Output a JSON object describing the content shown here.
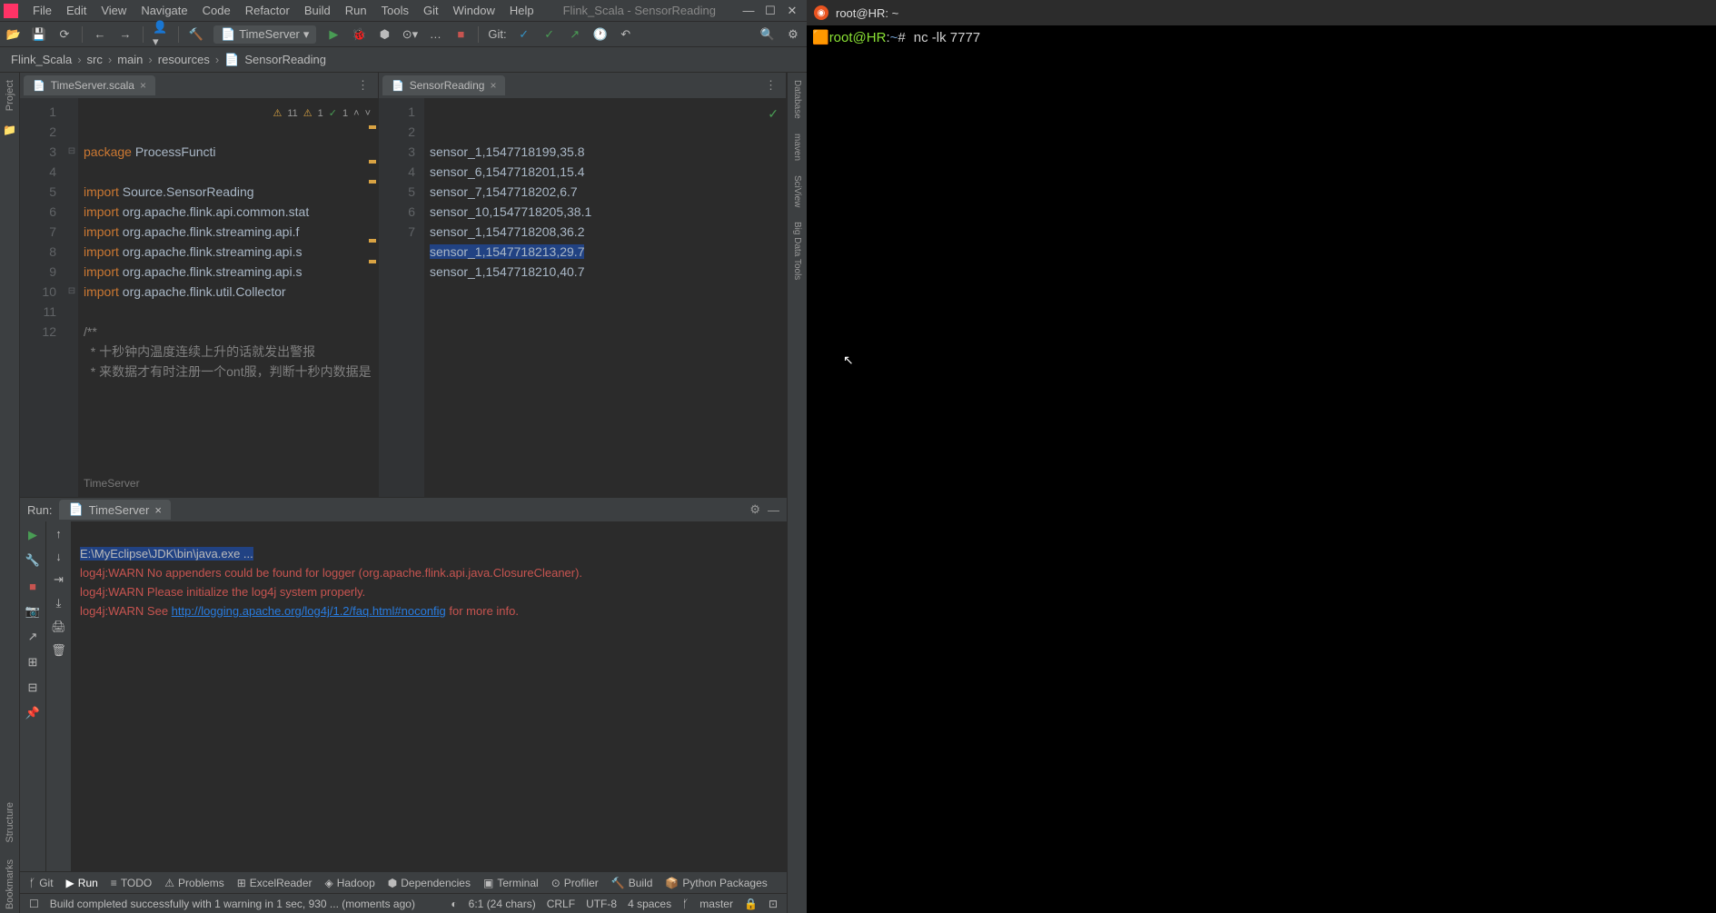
{
  "menubar": {
    "items": [
      "File",
      "Edit",
      "View",
      "Navigate",
      "Code",
      "Refactor",
      "Build",
      "Run",
      "Tools",
      "Git",
      "Window",
      "Help"
    ],
    "project": "Flink_Scala - SensorReading"
  },
  "toolbar": {
    "runconfig": "TimeServer",
    "git_label": "Git:"
  },
  "breadcrumb": [
    "Flink_Scala",
    "src",
    "main",
    "resources",
    "SensorReading"
  ],
  "tabs": {
    "left": "TimeServer.scala",
    "right": "SensorReading"
  },
  "code_left": {
    "lines": [
      {
        "n": "1",
        "t": "package ProcessFuncti",
        "cls": ""
      },
      {
        "n": "2",
        "t": "",
        "cls": ""
      },
      {
        "n": "3",
        "t": "import Source.SensorReading",
        "cls": ""
      },
      {
        "n": "4",
        "t": "import org.apache.flink.api.common.stat",
        "cls": ""
      },
      {
        "n": "5",
        "t": "import org.apache.flink.streaming.api.f",
        "cls": ""
      },
      {
        "n": "6",
        "t": "import org.apache.flink.streaming.api.s",
        "cls": ""
      },
      {
        "n": "7",
        "t": "import org.apache.flink.streaming.api.s",
        "cls": ""
      },
      {
        "n": "8",
        "t": "import org.apache.flink.util.Collector",
        "cls": ""
      },
      {
        "n": "9",
        "t": "",
        "cls": ""
      },
      {
        "n": "10",
        "t": "/**",
        "cls": "comment"
      },
      {
        "n": "11",
        "t": "  * 十秒钟内温度连续上升的话就发出警报",
        "cls": "comment"
      },
      {
        "n": "12",
        "t": "  * 来数据才有时注册一个ont服，判断十秒内数据是",
        "cls": "comment"
      }
    ],
    "indicators": {
      "warn": "11",
      "err": "1",
      "ok": "1"
    },
    "context": "TimeServer"
  },
  "code_right": {
    "lines": [
      {
        "n": "1",
        "t": "sensor_1,1547718199,35.8"
      },
      {
        "n": "2",
        "t": "sensor_6,1547718201,15.4"
      },
      {
        "n": "3",
        "t": "sensor_7,1547718202,6.7"
      },
      {
        "n": "4",
        "t": "sensor_10,1547718205,38.1"
      },
      {
        "n": "5",
        "t": "sensor_1,1547718208,36.2"
      },
      {
        "n": "6",
        "t": "sensor_1,1547718213,29.7",
        "sel": true
      },
      {
        "n": "7",
        "t": "sensor_1,1547718210,40.7"
      }
    ]
  },
  "run": {
    "label": "Run:",
    "tab": "TimeServer",
    "console": {
      "line1": "E:\\MyEclipse\\JDK\\bin\\java.exe ...",
      "line2": "log4j:WARN No appenders could be found for logger (org.apache.flink.api.java.ClosureCleaner).",
      "line3": "log4j:WARN Please initialize the log4j system properly.",
      "line4a": "log4j:WARN See ",
      "line4_link": "http://logging.apache.org/log4j/1.2/faq.html#noconfig",
      "line4b": " for more info."
    }
  },
  "bottom_tabs": [
    "Git",
    "Run",
    "TODO",
    "Problems",
    "ExcelReader",
    "Hadoop",
    "Dependencies",
    "Terminal",
    "Profiler",
    "Build",
    "Python Packages"
  ],
  "status": {
    "build": "Build completed successfully with 1 warning in 1 sec, 930 ... (moments ago)",
    "pos": "6:1 (24 chars)",
    "sep": "CRLF",
    "enc": "UTF-8",
    "indent": "4 spaces",
    "branch": "master"
  },
  "left_side_tabs": [
    "Project",
    "Bookmarks",
    "Structure"
  ],
  "right_side_tabs": [
    "Database",
    "maven",
    "SciView",
    "Big Data Tools"
  ],
  "terminal": {
    "title": "root@HR: ~",
    "prompt_user": "root@HR",
    "prompt_path": "~",
    "prompt_sep": ":",
    "prompt_end": "#",
    "command": "nc -lk 7777"
  }
}
